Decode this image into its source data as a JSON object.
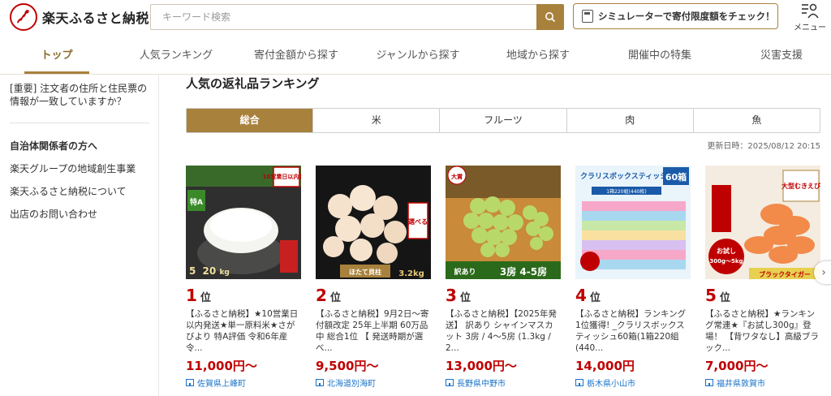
{
  "brand": {
    "name": "楽天ふるさと納税",
    "logo_icon": "japan-map-icon",
    "brand_color": "#bf0000",
    "accent_color": "#a8813c"
  },
  "search": {
    "placeholder": "キーワード検索",
    "value": ""
  },
  "simulator_button": {
    "label": "シミュレーターで寄付限度額をチェック！",
    "icon": "calculator-icon"
  },
  "menu": {
    "label": "メニュー",
    "icon": "menu-user-icon"
  },
  "nav": {
    "items": [
      {
        "label": "トップ",
        "active": true
      },
      {
        "label": "人気ランキング"
      },
      {
        "label": "寄付金額から探す"
      },
      {
        "label": "ジャンルから探す"
      },
      {
        "label": "地域から探す"
      },
      {
        "label": "開催中の特集"
      },
      {
        "label": "災害支援"
      }
    ]
  },
  "sidebar": {
    "notice": "[重要] 注文者の住所と住民票の情報が一致していますか？",
    "heading": "自治体関係者の方へ",
    "links": [
      "楽天グループの地域創生事業",
      "楽天ふるさと納税について",
      "出店のお問い合わせ"
    ]
  },
  "ranking": {
    "title": "人気の返礼品ランキング",
    "tabs": [
      "総合",
      "米",
      "フルーツ",
      "肉",
      "魚"
    ],
    "active_tab": "総合",
    "updated": "更新日時：2025/08/12 20:15",
    "rank_suffix": "位",
    "items": [
      {
        "rank": "1",
        "desc": "【ふるさと納税】★10営業日以内発送★単一原料米★さがびより 特A評価 令和6年産 令...",
        "price": "11,000円〜",
        "region": "佐賀県上峰町",
        "image": {
          "banner_top": "10営業日以内発送",
          "badge": "特A",
          "weights": [
            "5",
            "20",
            "kg"
          ]
        }
      },
      {
        "rank": "2",
        "desc": "【ふるさと納税】9月2日〜寄付額改定 25年上半期 60万品中 総合1位 【 発送時期が選べ...",
        "price": "9,500円〜",
        "region": "北海道別海町",
        "image": {
          "side_label": "選べる",
          "bottom_label": "ほたて貝柱",
          "weight": "3.2kg"
        }
      },
      {
        "rank": "3",
        "desc": "【ふるさと納税】【2025年発送】 訳あり シャインマスカット 3房 / 4〜5房 (1.3kg / 2...",
        "price": "13,000円〜",
        "region": "長野県中野市",
        "image": {
          "badge": "大賞",
          "bottom_label": "訳あり",
          "count": "3房 4-5房"
        }
      },
      {
        "rank": "4",
        "desc": "【ふるさと納税】ランキング1位獲得! _クラリスボックスティッシュ60箱(1箱220組(440...",
        "price": "14,000円",
        "region": "栃木県小山市",
        "image": {
          "headline": "クラリスボックスティッシュ",
          "count": "60箱",
          "sub": "1箱220組(440枚)"
        }
      },
      {
        "rank": "5",
        "desc": "【ふるさと納税】★ランキング常連★『お試し300g』登場！ 【背ワタなし】高級ブラック...",
        "price": "7,000円〜",
        "region": "福井県敦賀市",
        "image": {
          "badge": "大型むきえび",
          "trial": "お試し",
          "weight": "300g〜5kg",
          "bottom_label": "ブラックタイガー"
        }
      }
    ]
  }
}
